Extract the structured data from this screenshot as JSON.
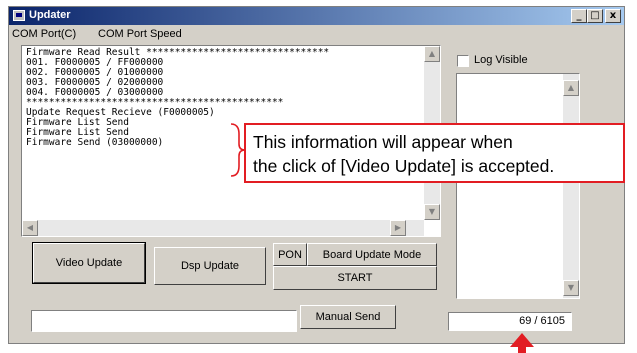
{
  "window": {
    "title": "Updater",
    "controls": [
      "_",
      "□",
      "x"
    ]
  },
  "menu": [
    "COM Port(C)",
    "COM Port Speed"
  ],
  "log_lines": [
    "Firmware Read Result ********************************",
    "001. F0000005 / FF000000",
    "002. F0000005 / 01000000",
    "003. F0000005 / 02000000",
    "004. F0000005 / 03000000",
    "*********************************************",
    "Update Request Recieve (F0000005)",
    "Firmware List Send",
    "Firmware List Send",
    "Firmware Send (03000000)"
  ],
  "buttons": {
    "video_update": "Video Update",
    "dsp_update": "Dsp Update",
    "pon": "PON",
    "board_update_mode": "Board Update Mode",
    "start": "START",
    "manual_send": "Manual Send"
  },
  "log_visible": {
    "label": "Log Visible",
    "checked": false
  },
  "manual_input": {
    "value": ""
  },
  "counter": "69 / 6105",
  "callout": {
    "line1": "This information will appear when",
    "line2": "the click of [Video Update] is accepted."
  },
  "colors": {
    "titlebar": "#0a246a",
    "callout_border": "#e21d23",
    "window_face": "#d4d0c8"
  }
}
